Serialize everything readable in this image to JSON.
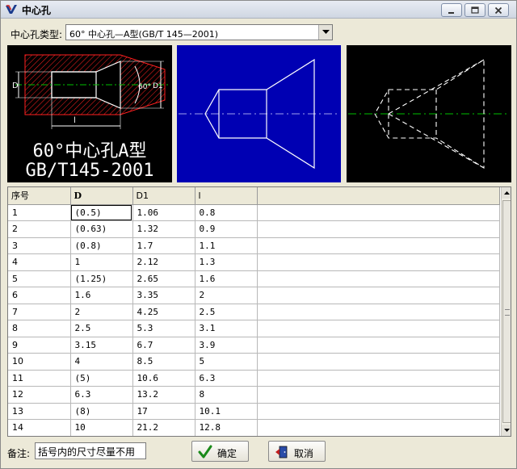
{
  "window": {
    "title": "中心孔"
  },
  "type_selector": {
    "label": "中心孔类型:",
    "value": "60° 中心孔—A型(GB/T 145—2001)"
  },
  "preview": {
    "caption_line1": "60°中心孔A型",
    "caption_line2": "GB/T145-2001",
    "dim_60": "60°",
    "dim_D": "D",
    "dim_D1": "D1",
    "dim_l": "l"
  },
  "table": {
    "columns": [
      "序号",
      "D",
      "D1",
      "l"
    ],
    "rows": [
      [
        "1",
        "(0.5)",
        "1.06",
        "0.8"
      ],
      [
        "2",
        "(0.63)",
        "1.32",
        "0.9"
      ],
      [
        "3",
        "(0.8)",
        "1.7",
        "1.1"
      ],
      [
        "4",
        "1",
        "2.12",
        "1.3"
      ],
      [
        "5",
        "(1.25)",
        "2.65",
        "1.6"
      ],
      [
        "6",
        "1.6",
        "3.35",
        "2"
      ],
      [
        "7",
        "2",
        "4.25",
        "2.5"
      ],
      [
        "8",
        "2.5",
        "5.3",
        "3.1"
      ],
      [
        "9",
        "3.15",
        "6.7",
        "3.9"
      ],
      [
        "10",
        "4",
        "8.5",
        "5"
      ],
      [
        "11",
        "(5)",
        "10.6",
        "6.3"
      ],
      [
        "12",
        "6.3",
        "13.2",
        "8"
      ],
      [
        "13",
        "(8)",
        "17",
        "10.1"
      ],
      [
        "14",
        "10",
        "21.2",
        "12.8"
      ]
    ]
  },
  "footer": {
    "note_label": "备注:",
    "note_value": "括号内的尺寸尽量不用",
    "ok_label": "确定",
    "cancel_label": "取消"
  },
  "colors": {
    "preview_blue": "#0000b3",
    "hatch_red": "#ff2020",
    "center_green": "#00c000"
  }
}
